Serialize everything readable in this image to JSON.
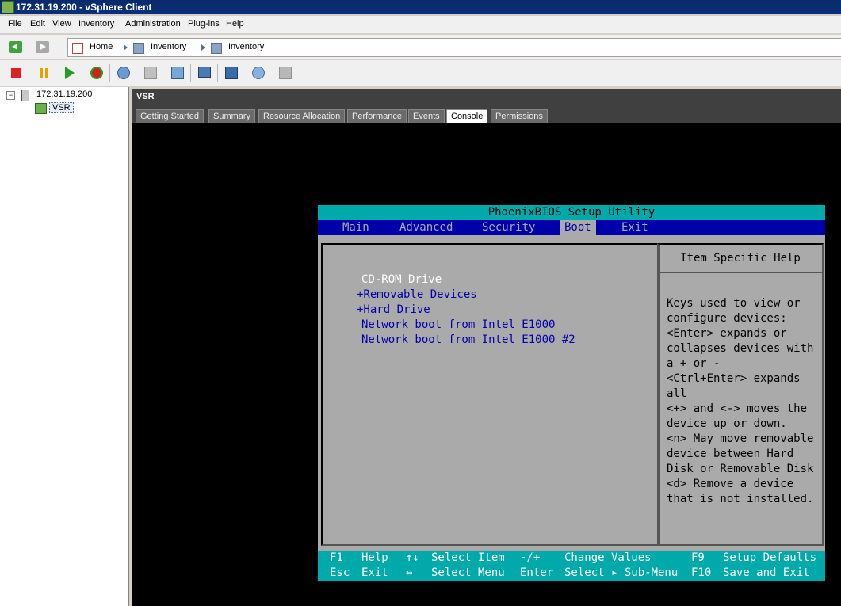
{
  "window": {
    "title": "172.31.19.200 - vSphere Client"
  },
  "menu": [
    "File",
    "Edit",
    "View",
    "Inventory",
    "Administration",
    "Plug-ins",
    "Help"
  ],
  "breadcrumb": [
    "Home",
    "Inventory",
    "Inventory"
  ],
  "tree": {
    "host": "172.31.19.200",
    "vm": "VSR"
  },
  "vm_panel": {
    "title": "VSR",
    "tabs": [
      "Getting Started",
      "Summary",
      "Resource Allocation",
      "Performance",
      "Events",
      "Console",
      "Permissions"
    ],
    "active_tab": "Console"
  },
  "bios": {
    "title": "PhoenixBIOS Setup Utility",
    "menu": [
      "Main",
      "Advanced",
      "Security",
      "Boot",
      "Exit"
    ],
    "active_menu": "Boot",
    "boot_items": [
      "CD-ROM Drive",
      "+Removable Devices",
      "+Hard Drive",
      "Network boot from Intel E1000",
      "Network boot from Intel E1000 #2"
    ],
    "help_title": "Item Specific Help",
    "help_lines": [
      "Keys used to view or",
      "configure devices:",
      "<Enter> expands or",
      "collapses devices with",
      "a + or -",
      "<Ctrl+Enter> expands",
      "all",
      "<+> and <-> moves the",
      "device up or down.",
      "<n> May move removable",
      "device between Hard",
      "Disk or Removable Disk",
      "<d> Remove a device",
      "that is not installed."
    ],
    "footer": {
      "row1": [
        {
          "key": "F1",
          "desc": "Help"
        },
        {
          "key": "↑↓",
          "desc": "Select Item"
        },
        {
          "key": "-/+",
          "desc": "Change Values"
        },
        {
          "key": "F9",
          "desc": "Setup Defaults"
        }
      ],
      "row2": [
        {
          "key": "Esc",
          "desc": "Exit"
        },
        {
          "key": "↔",
          "desc": "Select Menu"
        },
        {
          "key": "Enter",
          "desc": "Select ▸ Sub-Menu"
        },
        {
          "key": "F10",
          "desc": "Save and Exit"
        }
      ]
    }
  }
}
